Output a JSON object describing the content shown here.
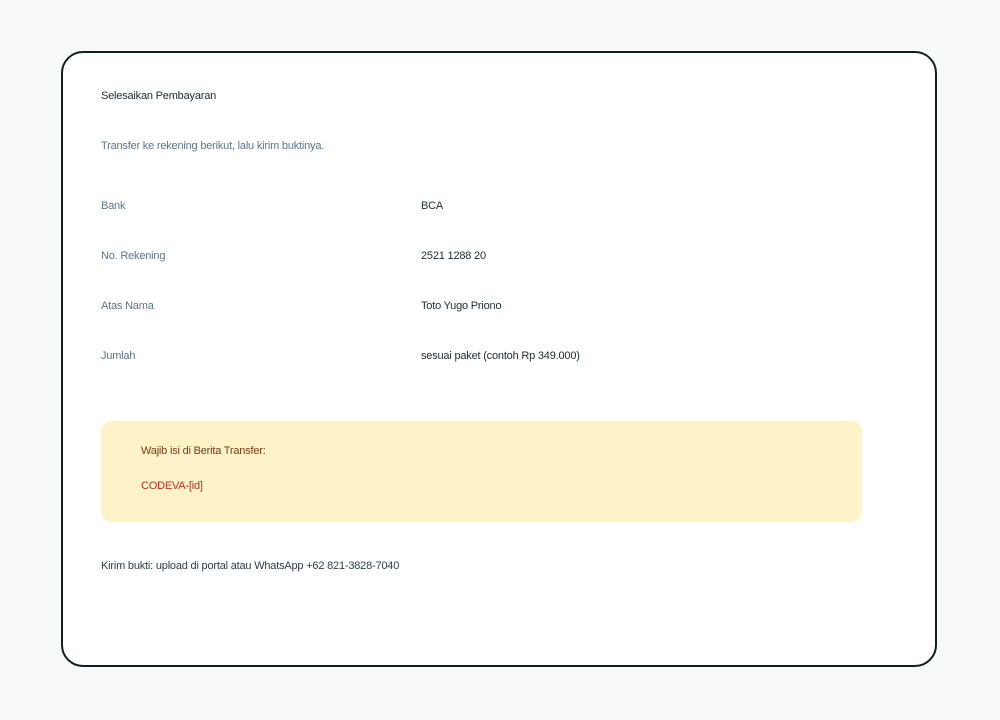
{
  "title": "Selesaikan Pembayaran",
  "subtitle": "Transfer ke rekening berikut, lalu kirim buktinya.",
  "details": [
    {
      "label": "Bank",
      "value": "BCA"
    },
    {
      "label": "No. Rekening",
      "value": "2521 1288 20"
    },
    {
      "label": "Atas Nama",
      "value": "Toto Yugo Priono"
    },
    {
      "label": "Jumlah",
      "value": "sesuai paket (contoh Rp 349.000)"
    }
  ],
  "notice": {
    "label": "Wajib isi di Berita Transfer:",
    "code": "CODEVA-[id]"
  },
  "footer": "Kirim bukti: upload di portal atau WhatsApp +62 821-3828-7040",
  "colors": {
    "background": "#f8f9fb",
    "card_border": "#10201f",
    "notice_bg": "#fdf2c8",
    "notice_label": "#7a3a14",
    "notice_code": "#b8321c",
    "muted_text": "#5b7586"
  }
}
